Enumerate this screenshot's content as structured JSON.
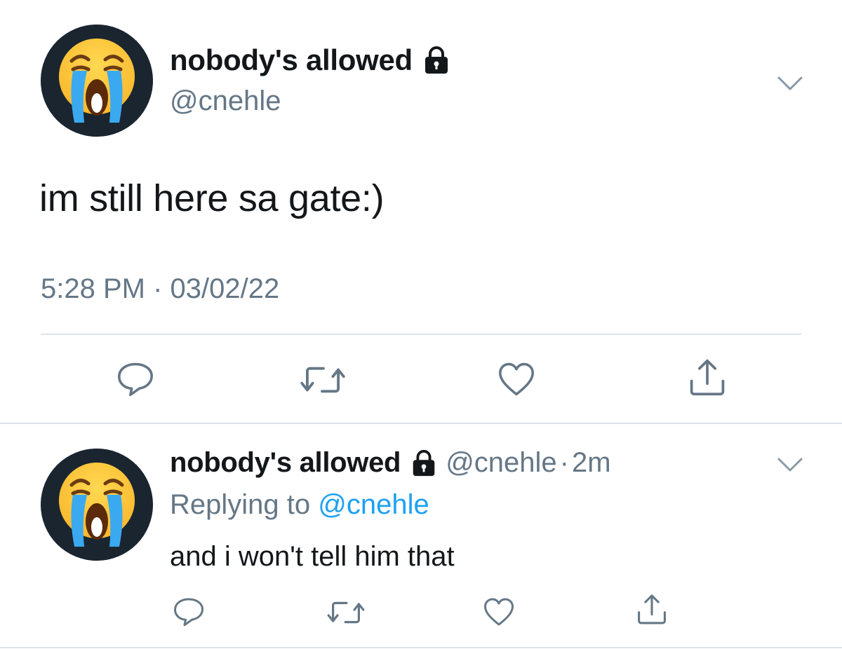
{
  "main_tweet": {
    "display_name": "nobody's allowed",
    "handle": "@cnehle",
    "text": "im still here sa gate:)",
    "timestamp": "5:28 PM · 03/02/22",
    "avatar_icon": "loudly-crying-face-emoji",
    "verified_icon": "lock-icon",
    "actions": [
      "reply-icon",
      "retweet-icon",
      "like-icon",
      "share-icon"
    ]
  },
  "reply_tweet": {
    "display_name": "nobody's allowed",
    "handle": "@cnehle",
    "separator": "·",
    "age": "2m",
    "replying_prefix": "Replying to",
    "replying_to": "@cnehle",
    "text": "and i won't tell him that",
    "avatar_icon": "loudly-crying-face-emoji",
    "actions": [
      "reply-icon",
      "retweet-icon",
      "like-icon",
      "share-icon"
    ]
  },
  "colors": {
    "text": "#14171a",
    "secondary": "#657786",
    "link": "#1da1f2",
    "divider": "#dfe3e7",
    "avatar_bg": "#1a2530"
  }
}
